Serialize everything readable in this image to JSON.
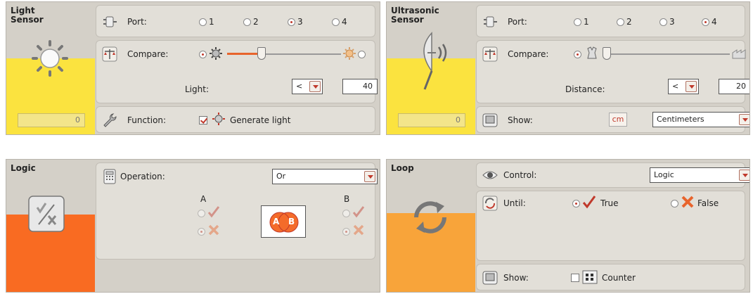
{
  "light": {
    "name": "Light\nSensor",
    "name_l1": "Light",
    "name_l2": "Sensor",
    "readout": "0",
    "port_label": "Port:",
    "ports": [
      "1",
      "2",
      "3",
      "4"
    ],
    "port_selected": "3",
    "compare_label": "Compare:",
    "slider_value_pct": 0.3,
    "light_label": "Light:",
    "operator": "<",
    "value": "40",
    "function_label": "Function:",
    "generate_light_label": "Generate light",
    "generate_light_checked": true
  },
  "ultrasonic": {
    "name_l1": "Ultrasonic",
    "name_l2": "Sensor",
    "readout": "0",
    "port_label": "Port:",
    "ports": [
      "1",
      "2",
      "3",
      "4"
    ],
    "port_selected": "4",
    "compare_label": "Compare:",
    "slider_value_pct": 0.03,
    "distance_label": "Distance:",
    "operator": "<",
    "value": "20",
    "show_label": "Show:",
    "unit_badge": "cm",
    "unit_selected": "Centimeters"
  },
  "logic": {
    "name": "Logic",
    "operation_label": "Operation:",
    "operation_selected": "Or",
    "a_label": "A",
    "b_label": "B",
    "venn_a": "A",
    "venn_b": "B"
  },
  "loop": {
    "name": "Loop",
    "control_label": "Control:",
    "control_selected": "Logic",
    "until_label": "Until:",
    "true_label": "True",
    "false_label": "False",
    "until_selected": "True",
    "show_label": "Show:",
    "counter_label": "Counter",
    "counter_checked": false
  },
  "colors": {
    "accent_red": "#c0392b",
    "sensor_yellow": "#fbe33f",
    "logic_orange": "#f96b22",
    "loop_orange": "#f8a43a",
    "panel_bg": "#d4d0c8"
  }
}
